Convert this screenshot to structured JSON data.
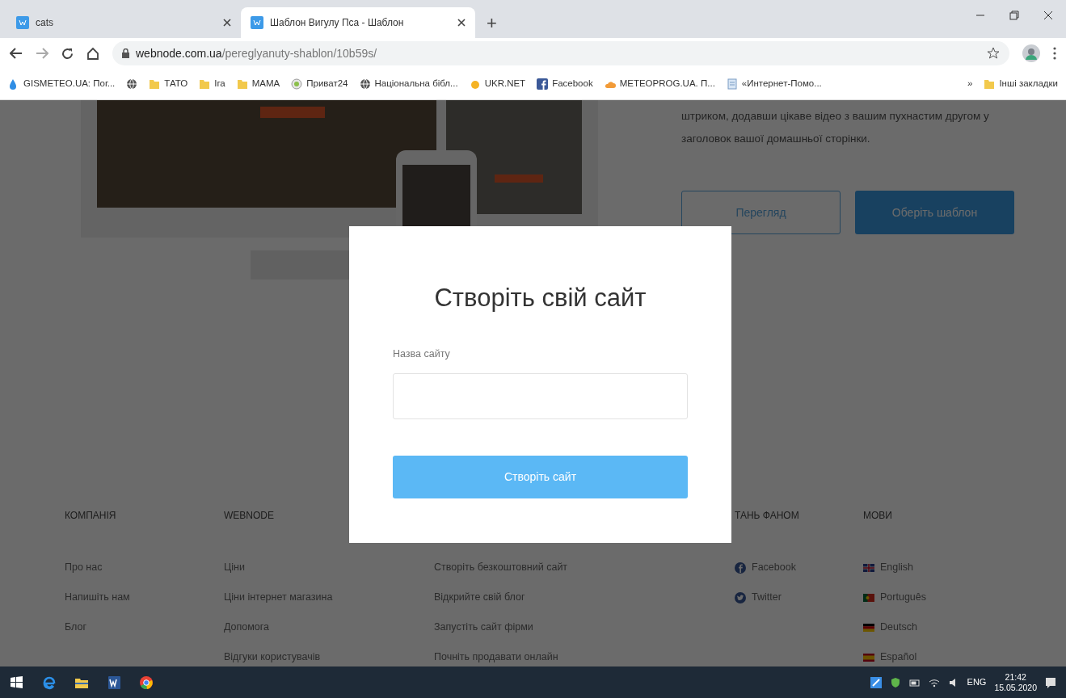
{
  "browser": {
    "tabs": [
      {
        "title": "cats",
        "selected": false
      },
      {
        "title": "Шаблон Вигулу Пса - Шаблон",
        "selected": true
      }
    ],
    "new_tab": "+",
    "url_host": "webnode.com.ua",
    "url_path": "/pereglyanuty-shablon/10b59s/",
    "bookmarks": [
      {
        "label": "GISMETEO.UA: Пог...",
        "kind": "drop"
      },
      {
        "kind": "globe"
      },
      {
        "label": "ТАТО",
        "kind": "folder"
      },
      {
        "label": "Іга",
        "kind": "folder"
      },
      {
        "label": "МАМА",
        "kind": "folder"
      },
      {
        "label": "Приват24",
        "kind": "coin"
      },
      {
        "label": "Національна бібл...",
        "kind": "globe"
      },
      {
        "label": "UKR.NET",
        "kind": "sun"
      },
      {
        "label": "Facebook",
        "kind": "facebook"
      },
      {
        "label": "METEOPROG.UA. П...",
        "kind": "cloud"
      },
      {
        "label": "«Интернет-Помо...",
        "kind": "page"
      }
    ],
    "overflow": "»",
    "other_bookmarks": "Інші закладки"
  },
  "page": {
    "intro": "штриком, додавши цікаве відео з вашим пухнастим другом у заголовок вашої домашньої сторінки.",
    "buttons": [
      {
        "label": "Перегляд",
        "kind": "outline"
      },
      {
        "label": "Оберіть шаблон",
        "kind": "primary"
      }
    ],
    "footer": [
      {
        "heading": "КОМПАНІЯ",
        "links": [
          {
            "label": "Про нас"
          },
          {
            "label": "Напишіть нам"
          },
          {
            "label": "Блог"
          }
        ]
      },
      {
        "heading": "WEBNODE",
        "links": [
          {
            "label": "Ціни"
          },
          {
            "label": "Ціни інтернет магазина"
          },
          {
            "label": "Допомога"
          },
          {
            "label": "Відгуки користувачів"
          }
        ]
      },
      {
        "links": [
          {
            "label": "Створіть безкоштовний сайт"
          },
          {
            "label": "Відкрийте свій блог"
          },
          {
            "label": "Запустіть сайт фірми"
          },
          {
            "label": "Почніть продавати онлайн"
          }
        ]
      },
      {
        "heading": "ТАНЬ ФАНОМ",
        "links": [
          {
            "label": "Facebook",
            "kind": "facebook"
          },
          {
            "label": "Twitter",
            "kind": "twitter"
          }
        ]
      },
      {
        "heading": "МОВИ",
        "links": [
          {
            "label": "English",
            "kind": "flag-uk"
          },
          {
            "label": "Português",
            "kind": "flag-pt"
          },
          {
            "label": "Deutsch",
            "kind": "flag-de"
          },
          {
            "label": "Español",
            "kind": "flag-es"
          }
        ]
      }
    ]
  },
  "modal": {
    "title": "Створіть свій сайт",
    "field_label": "Назва сайту",
    "submit": "Створіть сайт"
  },
  "taskbar": {
    "apps": [
      {
        "kind": "windows"
      },
      {
        "kind": "edge"
      },
      {
        "kind": "explorer"
      },
      {
        "kind": "word"
      },
      {
        "kind": "chrome"
      }
    ],
    "language": "ENG",
    "time": "21:42",
    "date": "15.05.2020"
  }
}
